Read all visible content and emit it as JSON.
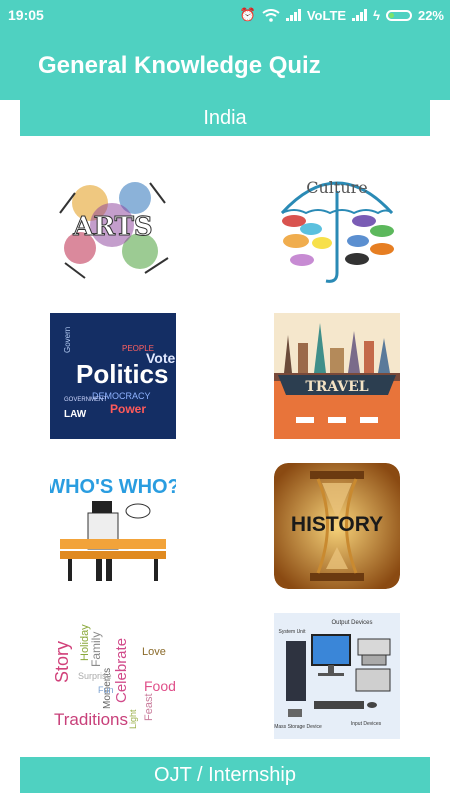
{
  "status": {
    "time": "19:05",
    "network": "VoLTE",
    "battery": "22%"
  },
  "app": {
    "title": "General Knowledge Quiz"
  },
  "sections": {
    "india": "India",
    "ojt": "OJT / Internship"
  },
  "tiles": {
    "arts": {
      "text": "ARTS"
    },
    "culture": {
      "text": "Culture"
    },
    "politics": {
      "text": "Politics",
      "words": [
        "Govern",
        "Vote",
        "LAW",
        "DEMOCRACY",
        "Power",
        "GOVERNMENT",
        "PEOPLE"
      ]
    },
    "travel": {
      "text": "TRAVEL"
    },
    "whoswho": {
      "text": "WHO'S WHO?"
    },
    "history": {
      "text": "HISTORY"
    },
    "traditions": {
      "words": [
        "Story",
        "Holiday",
        "Family",
        "Celebrate",
        "Food",
        "Traditions",
        "Moments",
        "Love",
        "Feast",
        "Light",
        "Fun",
        "Surprise"
      ]
    },
    "computer": {
      "labels": [
        "Output Devices",
        "System Unit",
        "Mass Storage Device",
        "Input Devices"
      ]
    }
  }
}
